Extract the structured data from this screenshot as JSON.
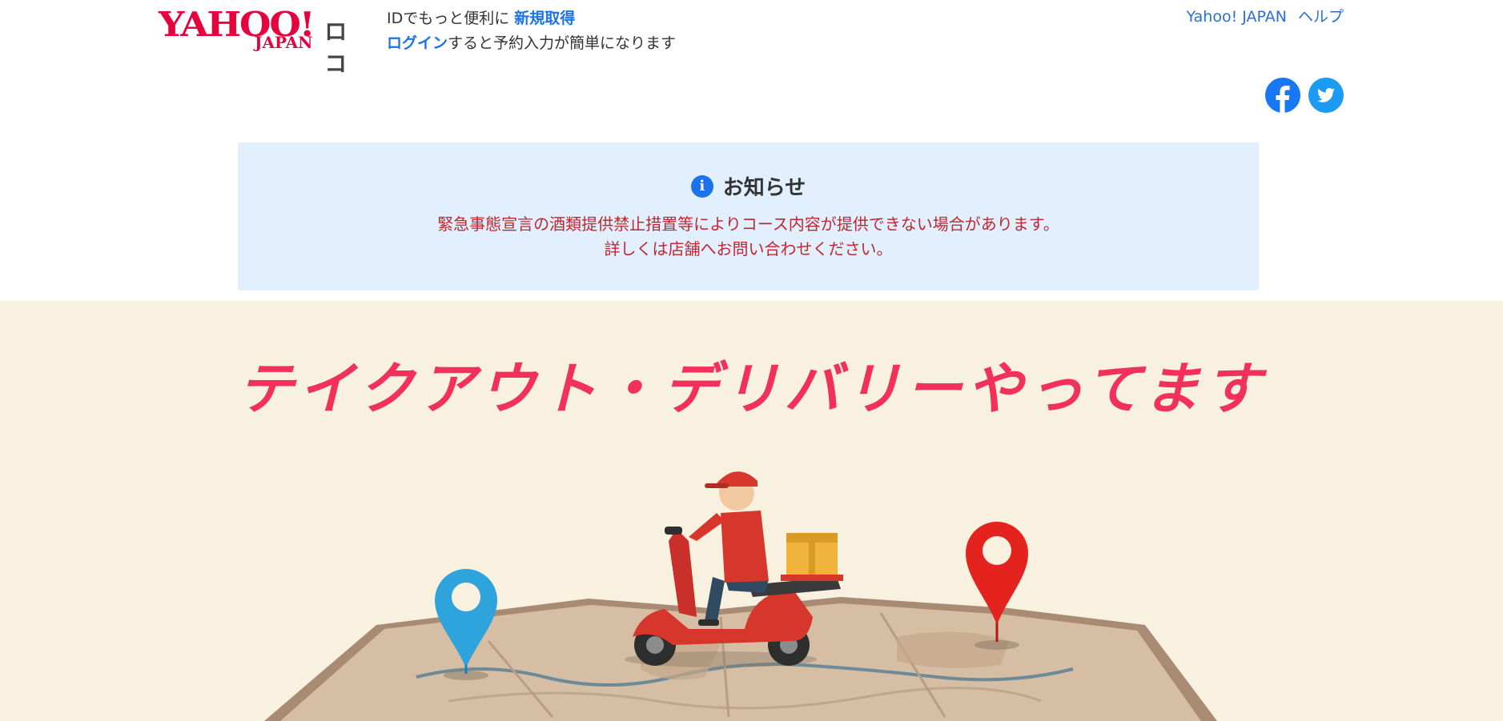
{
  "header": {
    "logo_text": "YAHOO!",
    "logo_subtext": "JAPAN",
    "service_name": "ロコ",
    "id_prompt": "IDでもっと便利に",
    "signup_link": "新規取得",
    "login_link": "ログイン",
    "login_suffix": "すると予約入力が簡単になります",
    "links": [
      "Yahoo! JAPAN",
      "ヘルプ"
    ]
  },
  "share": {
    "icons": [
      "facebook-icon",
      "twitter-icon"
    ]
  },
  "notice": {
    "icon": "info-icon",
    "title": "お知らせ",
    "line1": "緊急事態宣言の酒類提供禁止措置等によりコース内容が提供できない場合があります。",
    "line2": "詳しくは店舗へお問い合わせください。"
  },
  "banner": {
    "headline": "テイクアウト・デリバリーやってます"
  },
  "colors": {
    "brand_red": "#e6003e",
    "link_blue": "#1a73e8",
    "notice_bg": "#e1efff",
    "notice_text": "#c1272d",
    "banner_bg": "#f8f1e0",
    "headline": "#f1315a"
  }
}
